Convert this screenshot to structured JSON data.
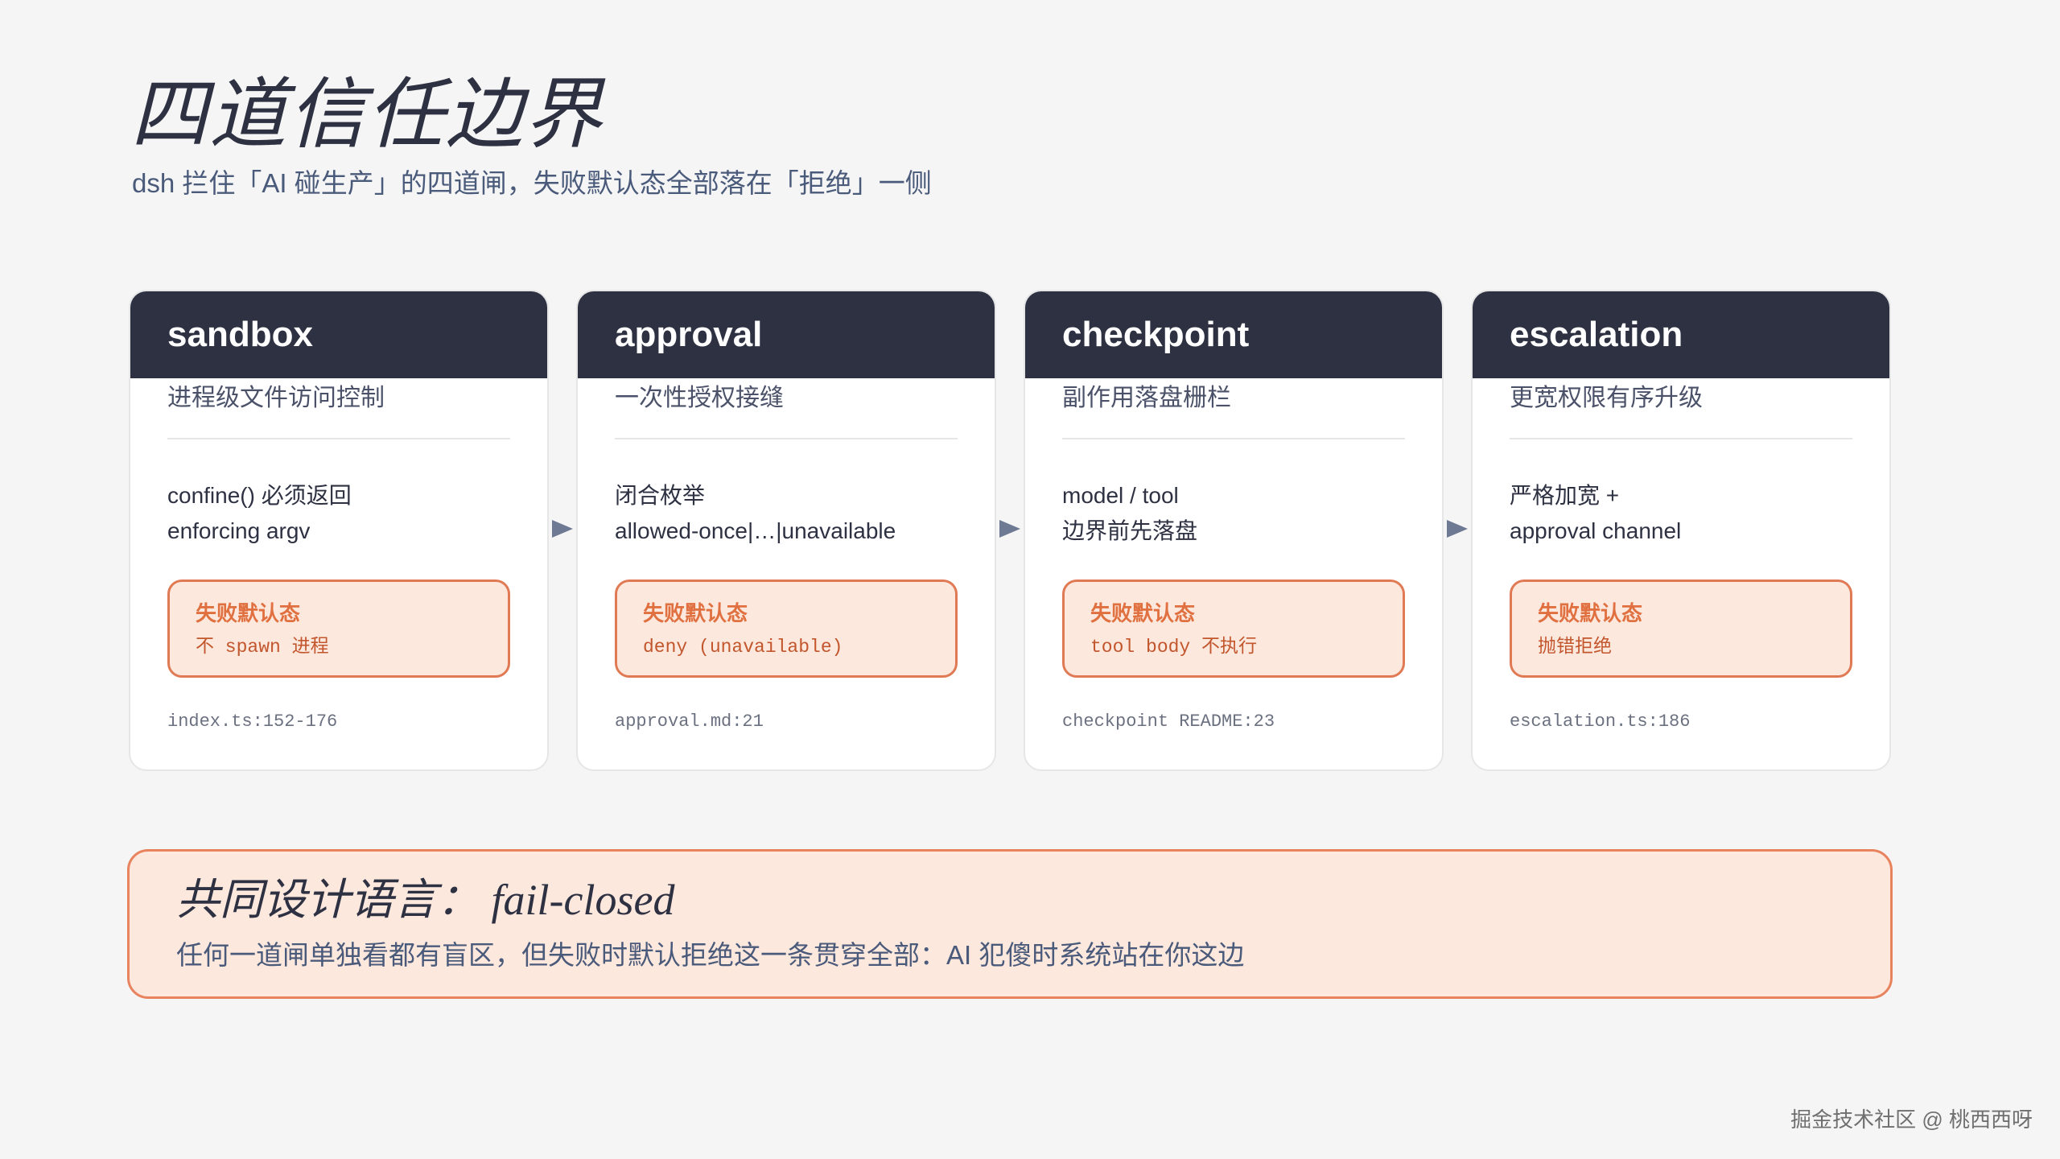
{
  "header": {
    "title": "四道信任边界",
    "subtitle": "dsh 拦住「AI 碰生产」的四道闸，失败默认态全部落在「拒绝」一侧"
  },
  "cards": [
    {
      "title": "sandbox",
      "subtitle": "进程级文件访问控制",
      "body_lines": [
        "confine() 必须返回",
        "enforcing argv"
      ],
      "fail_label": "失败默认态",
      "fail_value": "不 spawn 进程",
      "ref": "index.ts:152-176"
    },
    {
      "title": "approval",
      "subtitle": "一次性授权接缝",
      "body_lines": [
        "闭合枚举",
        "allowed-once|…|unavailable"
      ],
      "fail_label": "失败默认态",
      "fail_value": "deny (unavailable)",
      "ref": "approval.md:21"
    },
    {
      "title": "checkpoint",
      "subtitle": "副作用落盘栅栏",
      "body_lines": [
        "model / tool",
        "边界前先落盘"
      ],
      "fail_label": "失败默认态",
      "fail_value": "tool body 不执行",
      "ref": "checkpoint README:23"
    },
    {
      "title": "escalation",
      "subtitle": "更宽权限有序升级",
      "body_lines": [
        "严格加宽 +",
        "approval channel"
      ],
      "fail_label": "失败默认态",
      "fail_value": "抛错拒绝",
      "ref": "escalation.ts:186"
    }
  ],
  "summary": {
    "title": "共同设计语言： fail-closed",
    "text": "任何一道闸单独看都有盲区，但失败时默认拒绝这一条贯穿全部：AI 犯傻时系统站在你这边"
  },
  "watermark": "掘金技术社区 @ 桃西西呀",
  "colors": {
    "header_dark": "#2d3142",
    "accent_orange": "#e07a55",
    "accent_fill": "#fde8de",
    "arrow": "#6e7a94",
    "background": "#f5f5f5"
  }
}
